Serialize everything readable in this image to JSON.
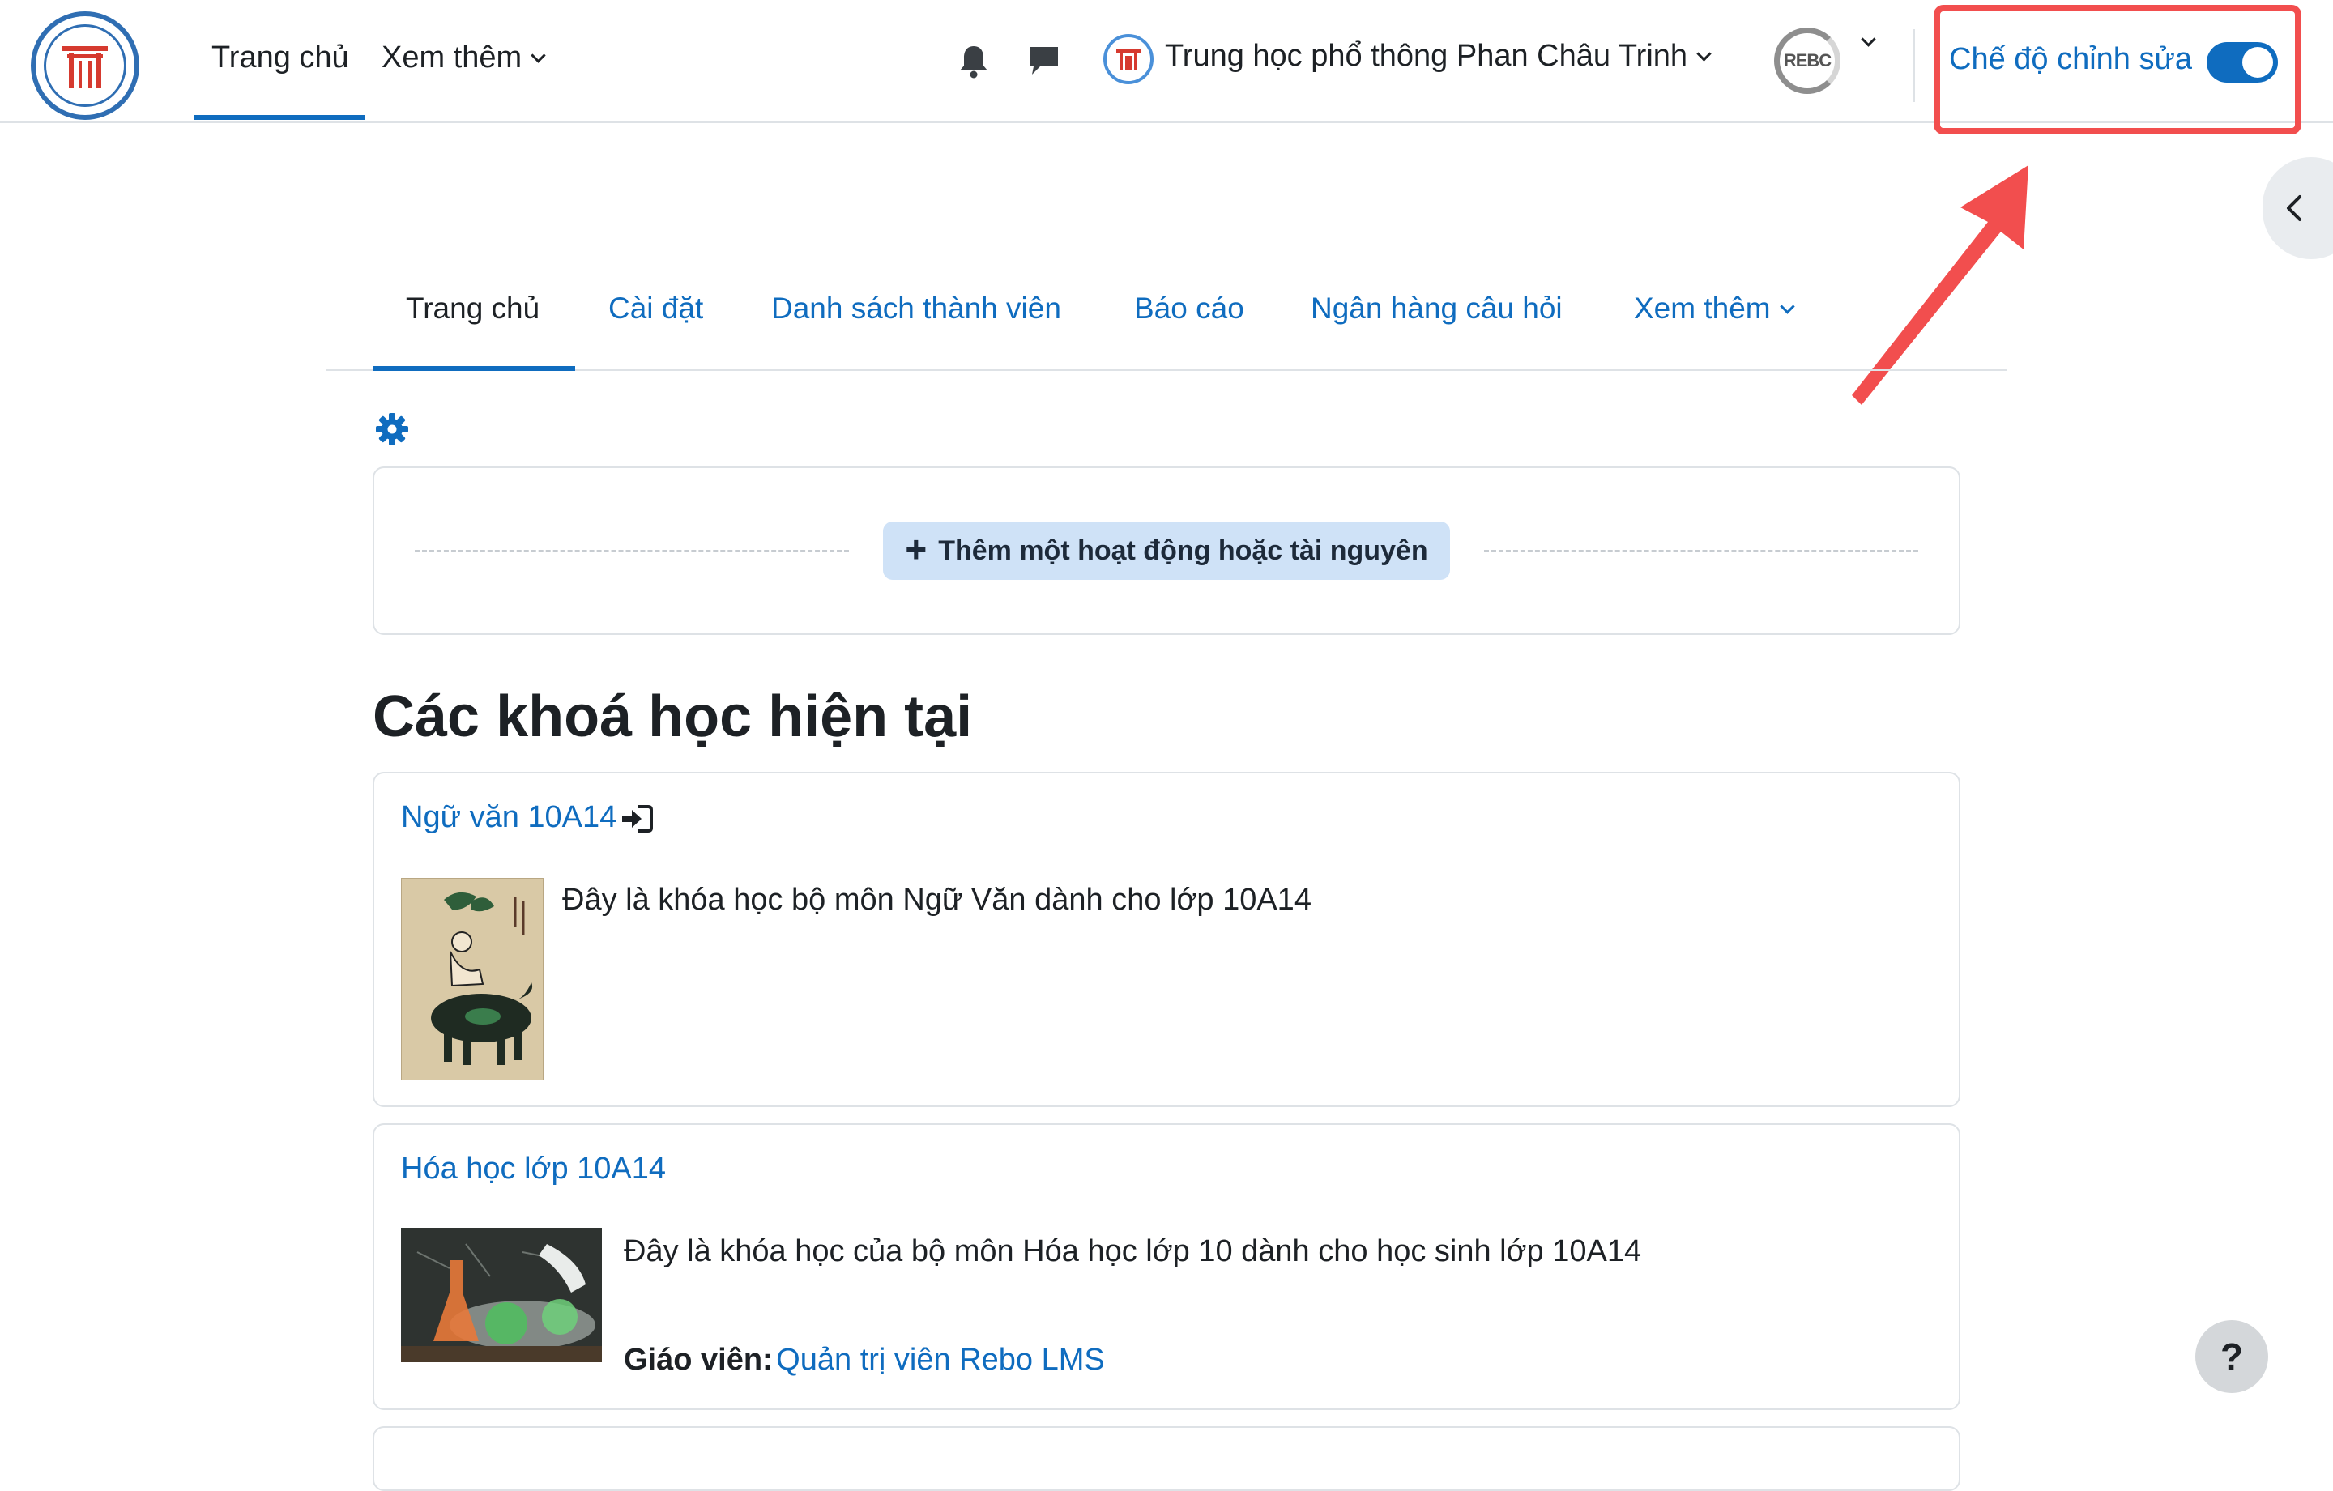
{
  "navbar": {
    "home_label": "Trang chủ",
    "more_label": "Xem thêm",
    "org_name": "Trung học phổ thông Phan Châu Trinh",
    "user_initials": "REBC",
    "edit_mode_label": "Chế độ chỉnh sửa",
    "edit_mode_on": true
  },
  "secondary_nav": {
    "tabs": [
      {
        "label": "Trang chủ",
        "active": true
      },
      {
        "label": "Cài đặt",
        "active": false
      },
      {
        "label": "Danh sách thành viên",
        "active": false
      },
      {
        "label": "Báo cáo",
        "active": false
      },
      {
        "label": "Ngân hàng câu hỏi",
        "active": false
      },
      {
        "label": "Xem thêm",
        "active": false
      }
    ]
  },
  "add_activity": {
    "label": "Thêm một hoạt động hoặc tài nguyên"
  },
  "courses_heading": "Các khoá học hiện tại",
  "courses": [
    {
      "title": "Ngữ văn 10A14",
      "description": "Đây là khóa học bộ môn Ngữ Văn dành cho lớp 10A14"
    },
    {
      "title": "Hóa học lớp 10A14",
      "description": "Đây là khóa học của bộ môn Hóa học lớp 10 dành cho học sinh lớp 10A14",
      "teacher_label": "Giáo viên:",
      "teacher_name": "Quản trị viên Rebo LMS"
    }
  ],
  "help_label": "?",
  "colors": {
    "accent": "#0f6cbf",
    "highlight": "#f24e4e",
    "add_button_bg": "#cfe2f7"
  }
}
